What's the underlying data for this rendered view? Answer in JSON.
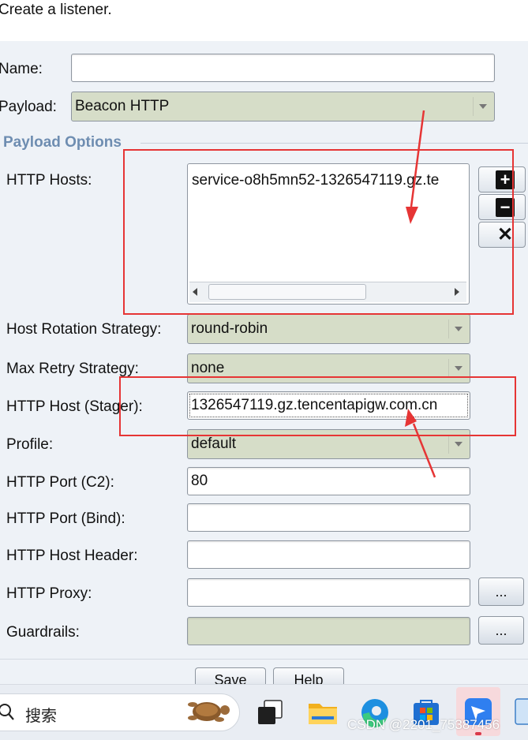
{
  "dialog": {
    "title": "Create a listener.",
    "name_label": "Name:",
    "name_value": "",
    "payload_label": "Payload:",
    "payload_value": "Beacon HTTP",
    "section_label": "Payload Options"
  },
  "options": {
    "http_hosts_label": "HTTP Hosts:",
    "http_hosts_items": [
      "service-o8h5mn52-1326547119.gz.te"
    ],
    "host_rotation_label": "Host Rotation Strategy:",
    "host_rotation_value": "round-robin",
    "max_retry_label": "Max Retry Strategy:",
    "max_retry_value": "none",
    "http_host_stager_label": "HTTP Host (Stager):",
    "http_host_stager_value": "1326547119.gz.tencentapigw.com.cn",
    "profile_label": "Profile:",
    "profile_value": "default",
    "http_port_c2_label": "HTTP Port (C2):",
    "http_port_c2_value": "80",
    "http_port_bind_label": "HTTP Port (Bind):",
    "http_port_bind_value": "",
    "http_host_header_label": "HTTP Host Header:",
    "http_host_header_value": "",
    "http_proxy_label": "HTTP Proxy:",
    "http_proxy_value": "",
    "guardrails_label": "Guardrails:",
    "guardrails_value": "",
    "browse_label": "..."
  },
  "host_buttons": {
    "add": "+",
    "remove": "−",
    "clear": "✕"
  },
  "bottom_buttons": [
    "Save",
    "Help"
  ],
  "taskbar": {
    "search_placeholder": "搜索",
    "watermark": "CSDN @2201_75387456",
    "apps": [
      "task-view-icon",
      "file-explorer-icon",
      "edge-icon",
      "store-icon",
      "feishu-icon",
      "notepad-icon"
    ]
  },
  "colors": {
    "panel_bg": "#eef2f7",
    "combo_bg": "#d6ddc8",
    "section_title": "#6e8db1",
    "annotation_red": "#e63535"
  }
}
